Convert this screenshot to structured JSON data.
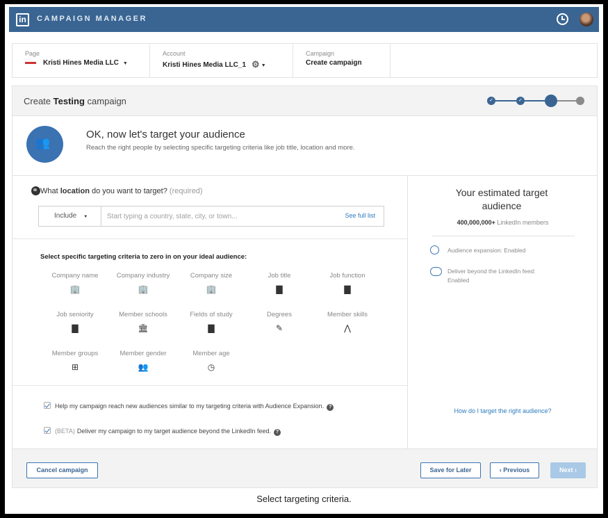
{
  "app": {
    "logo": "in",
    "title": "CAMPAIGN MANAGER",
    "icons": [
      "clock-icon",
      "avatar"
    ]
  },
  "breadcrumb": {
    "page": {
      "label": "Page",
      "value": "Kristi Hines Media LLC"
    },
    "account": {
      "label": "Account",
      "value": "Kristi Hines Media LLC_1"
    },
    "campaign": {
      "label": "Campaign",
      "value": "Create campaign"
    }
  },
  "header": {
    "prefix": "Create",
    "campaign_name": "Testing",
    "suffix": "campaign",
    "steps_total": 4,
    "current_step": 3
  },
  "intro": {
    "title": "OK, now let's target your audience",
    "subtitle": "Reach the right people by selecting specific targeting criteria like job title, location and more."
  },
  "location": {
    "question_pre": "What",
    "question_bold": "location",
    "question_post": "do you want to target?",
    "required": "(required)",
    "include_label": "Include",
    "placeholder": "Start typing a country, state, city, or town...",
    "see_full_list": "See full list"
  },
  "criteria": {
    "title": "Select specific targeting criteria to zero in on your ideal audience:",
    "items": [
      {
        "label": "Company name",
        "icon": "building-icon"
      },
      {
        "label": "Company industry",
        "icon": "building-icon"
      },
      {
        "label": "Company size",
        "icon": "building-icon"
      },
      {
        "label": "Job title",
        "icon": "document-icon"
      },
      {
        "label": "Job function",
        "icon": "document-icon"
      },
      {
        "label": "Job seniority",
        "icon": "document-icon"
      },
      {
        "label": "Member schools",
        "icon": "school-icon"
      },
      {
        "label": "Fields of study",
        "icon": "document-icon"
      },
      {
        "label": "Degrees",
        "icon": "diploma-icon"
      },
      {
        "label": "Member skills",
        "icon": "compass-icon"
      },
      {
        "label": "Member groups",
        "icon": "group-icon"
      },
      {
        "label": "Member gender",
        "icon": "people-icon"
      },
      {
        "label": "Member age",
        "icon": "clock-icon"
      }
    ]
  },
  "options": {
    "expansion": "Help my campaign reach new audiences similar to my targeting criteria with Audience Expansion.",
    "beyond_tag": "(BETA)",
    "beyond": "Deliver my campaign to my target audience beyond the LinkedIn feed."
  },
  "audience": {
    "title": "Your estimated target audience",
    "count": "400,000,000+",
    "count_suffix": "LinkedIn members",
    "expansion": "Audience expansion: Enabled",
    "beyond_line1": "Deliver beyond the LinkedIn feed:",
    "beyond_line2": "Enabled",
    "help_link": "How do I target the right audience?"
  },
  "footer": {
    "cancel": "Cancel campaign",
    "save": "Save for Later",
    "previous": "‹ Previous",
    "next": "Next ›"
  },
  "caption": "Select targeting criteria."
}
